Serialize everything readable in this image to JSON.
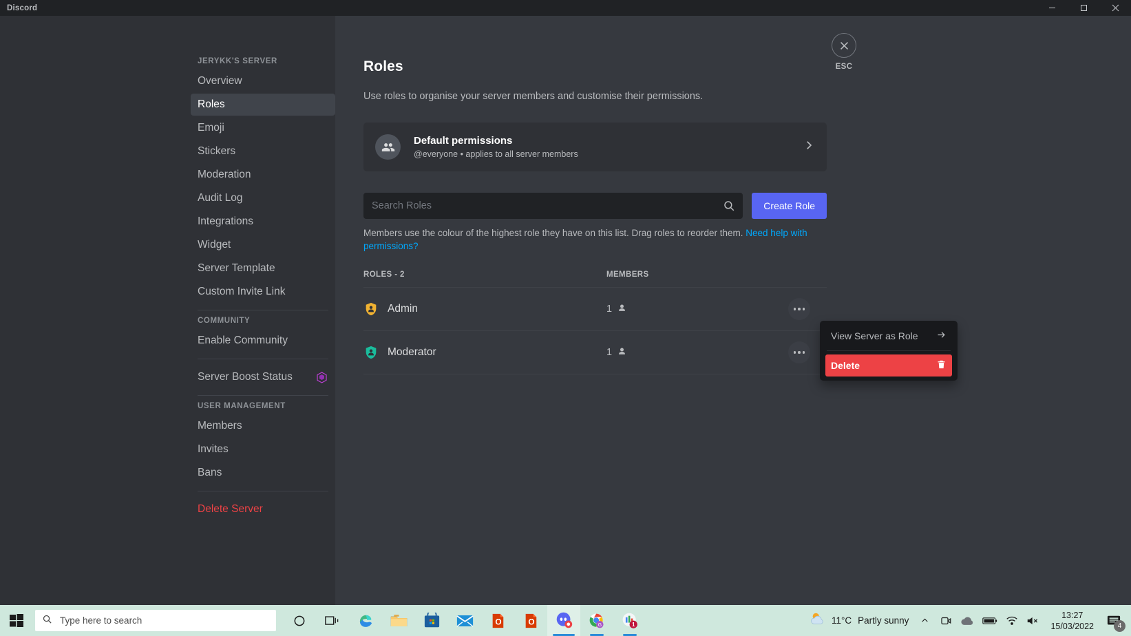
{
  "window": {
    "title": "Discord",
    "minimize_label": "Minimize",
    "maximize_label": "Maximize",
    "close_label": "Close"
  },
  "sidebar": {
    "server_header": "JERYKK'S SERVER",
    "server_items": [
      {
        "label": "Overview"
      },
      {
        "label": "Roles"
      },
      {
        "label": "Emoji"
      },
      {
        "label": "Stickers"
      },
      {
        "label": "Moderation"
      },
      {
        "label": "Audit Log"
      },
      {
        "label": "Integrations"
      },
      {
        "label": "Widget"
      },
      {
        "label": "Server Template"
      },
      {
        "label": "Custom Invite Link"
      }
    ],
    "community_header": "COMMUNITY",
    "community_items": [
      {
        "label": "Enable Community"
      }
    ],
    "boost_item": {
      "label": "Server Boost Status"
    },
    "user_management_header": "USER MANAGEMENT",
    "user_items": [
      {
        "label": "Members"
      },
      {
        "label": "Invites"
      },
      {
        "label": "Bans"
      }
    ],
    "delete_server": "Delete Server"
  },
  "esc": {
    "label": "ESC"
  },
  "main": {
    "title": "Roles",
    "subtitle": "Use roles to organise your server members and customise their permissions.",
    "default_permissions": {
      "title": "Default permissions",
      "description": "@everyone • applies to all server members"
    },
    "search": {
      "placeholder": "Search Roles",
      "value": ""
    },
    "create_role_label": "Create Role",
    "hint_text": "Members use the colour of the highest role they have on this list. Drag roles to reorder them. ",
    "hint_link": "Need help with permissions?",
    "table": {
      "col_roles": "ROLES - 2",
      "col_members": "MEMBERS",
      "rows": [
        {
          "name": "Admin",
          "members": "1",
          "color": "#f0b232"
        },
        {
          "name": "Moderator",
          "members": "1",
          "color": "#1abc9c"
        }
      ]
    }
  },
  "context_menu": {
    "view_as_role": "View Server as Role",
    "delete": "Delete"
  },
  "taskbar": {
    "search_placeholder": "Type here to search",
    "weather_temp": "11°C",
    "weather_condition": "Partly sunny",
    "time": "13:27",
    "date": "15/03/2022",
    "notification_count": "4",
    "teams_badge": "1"
  },
  "colors": {
    "accent": "#5865f2",
    "danger": "#ed4245",
    "link": "#00a8fc",
    "admin_role": "#f0b232",
    "moderator_role": "#1abc9c"
  }
}
